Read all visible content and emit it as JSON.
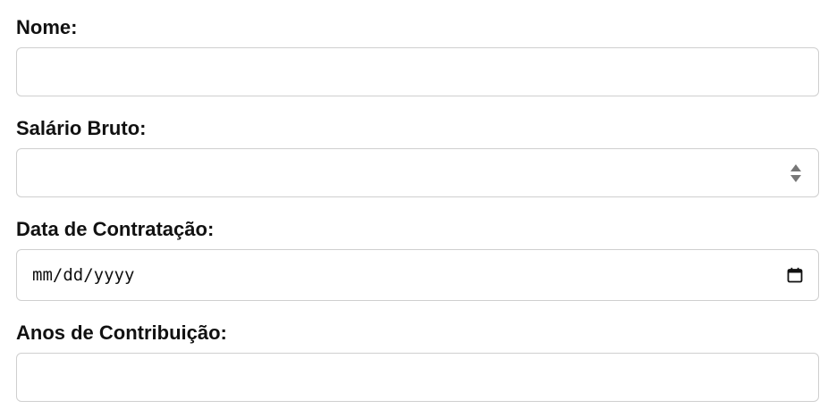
{
  "form": {
    "nome": {
      "label": "Nome:",
      "value": ""
    },
    "salario": {
      "label": "Salário Bruto:",
      "value": "",
      "stepper_icon": "spin-up-down-icon"
    },
    "data": {
      "label": "Data de Contratação:",
      "placeholder": "mm/dd/yyyy",
      "icon": "calendar-icon"
    },
    "anos": {
      "label": "Anos de Contribuição:",
      "value": ""
    }
  },
  "colors": {
    "border": "#cfcfcf",
    "stepper": "#777777",
    "text": "#111111"
  }
}
